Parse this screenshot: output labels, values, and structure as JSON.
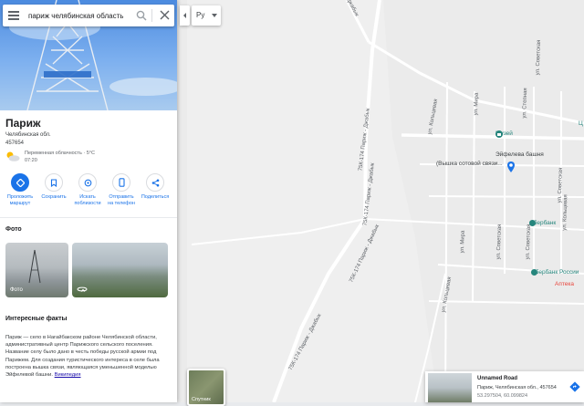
{
  "search": {
    "query": "париж челябинская область"
  },
  "place": {
    "title": "Париж",
    "region": "Челябинская обл.",
    "postal": "457654",
    "weather": "Переменная облачность · 5°C",
    "time": "07:20"
  },
  "actions": [
    {
      "label1": "Проложить",
      "label2": "маршрут",
      "icon": "directions-icon"
    },
    {
      "label1": "Сохранить",
      "label2": "",
      "icon": "bookmark-icon"
    },
    {
      "label1": "Искать",
      "label2": "поблизости",
      "icon": "nearby-icon"
    },
    {
      "label1": "Отправить",
      "label2": "на телефон",
      "icon": "send-to-phone-icon"
    },
    {
      "label1": "Поделиться",
      "label2": "",
      "icon": "share-icon"
    }
  ],
  "photos": {
    "heading": "Фото",
    "photo1_caption": "Фото"
  },
  "facts": {
    "heading": "Интересные факты",
    "text": "Париж — село в Нагайбакском районе Челябинской области, административный центр Парижского сельского поселения. Название селу было дано в честь победы русской армии под Парижем. Для создания туристического интереса в селе была построена вышка связи, являющаяся уменьшенной моделью Эйфелевой башни.",
    "link": "Википедия"
  },
  "language": {
    "value": "Ру"
  },
  "map": {
    "road_labels": [
      "75К-174 Париж - Джабык",
      "75К-174 Париж - Джабык",
      "75К-174 Париж - Джабык",
      "75К-174 Париж - Джабык"
    ],
    "street_labels": [
      "ул. Мира",
      "ул. Степная",
      "ул. Советская",
      "ул. Кольцевая",
      "ул. Кольцевая",
      "ул. Кольцевая",
      "ул. Мира",
      "ул. Советская",
      "ул. Советская",
      "ул. Советская"
    ],
    "pois": {
      "museum": "Музей",
      "tower_line1": "Эйфелева башня",
      "tower_line2": "(Вышка сотовой связи...",
      "sberbank": "Сбербанк",
      "sberbank_russia": "Сбербанк России",
      "pharmacy": "Аптека",
      "edge_letter": "Ц"
    }
  },
  "satellite": {
    "label": "Спутник"
  },
  "info_card": {
    "title": "Unnamed Road",
    "address": "Париж, Челябинская обл., 457654",
    "coords": "53.297504, 60.099824"
  },
  "colors": {
    "accent": "#1a73e8",
    "poi_teal": "#25857c",
    "pharmacy": "#e8453c"
  }
}
